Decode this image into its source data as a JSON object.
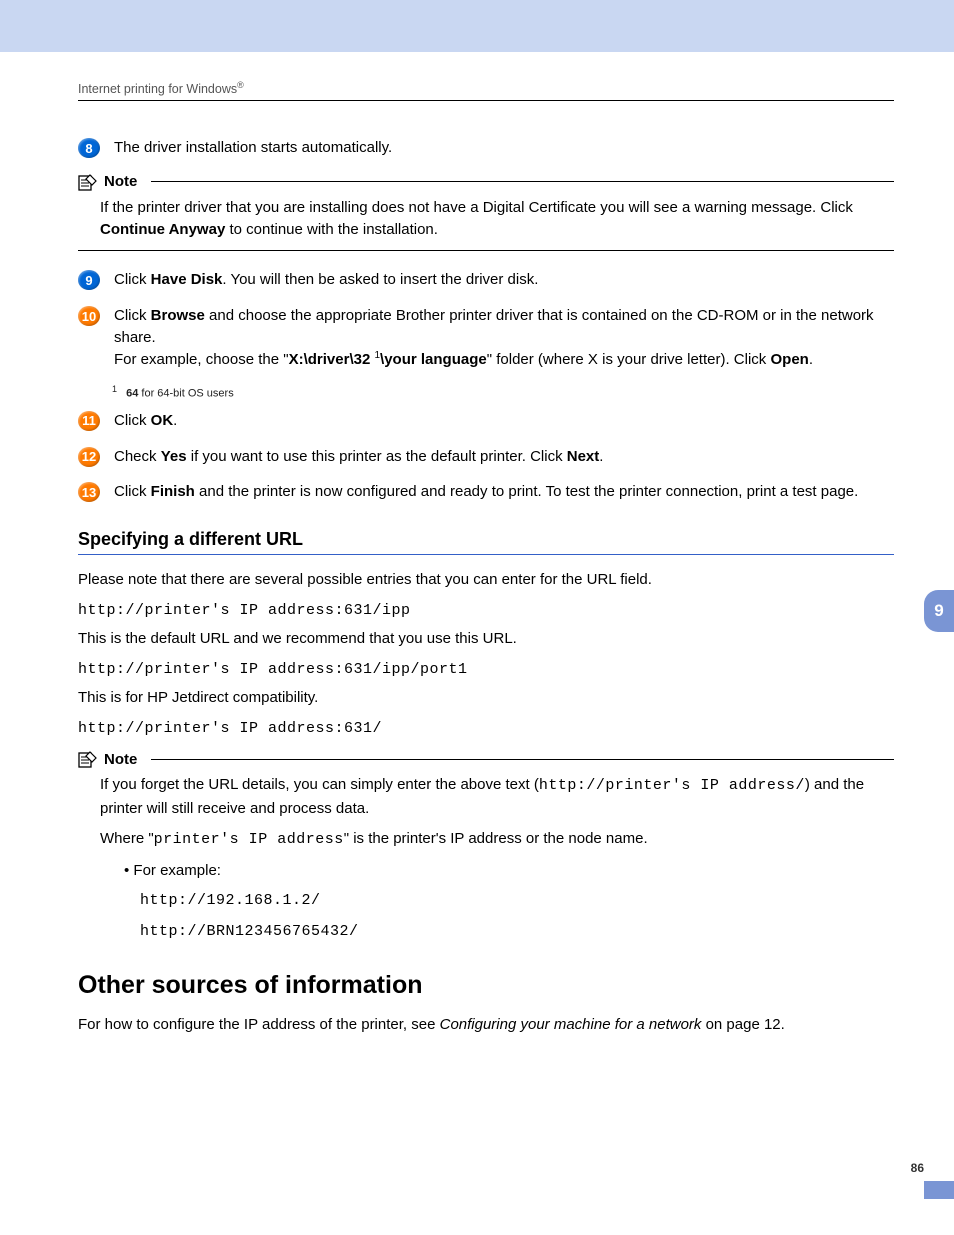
{
  "header": {
    "running_head": "Internet printing for Windows",
    "reg": "®"
  },
  "steps": [
    {
      "n": "8",
      "color": "blue",
      "html": "The driver installation starts automatically."
    },
    {
      "n": "9",
      "color": "blue",
      "html": "Click <b>Have Disk</b>. You will then be asked to insert the driver disk."
    },
    {
      "n": "10",
      "color": "orange",
      "html": "Click <b>Browse</b> and choose the appropriate Brother printer driver that is contained on the CD-ROM or in the network share.<br>For example, choose the \"<b>X:\\driver\\32</b> <sup class='supnote'>1</sup><b>\\your language</b>\" folder (where X is your drive letter). Click <b>Open</b>."
    },
    {
      "n": "11",
      "color": "orange",
      "html": "Click <b>OK</b>."
    },
    {
      "n": "12",
      "color": "orange",
      "html": "Check <b>Yes</b> if you want to use this printer as the default printer. Click <b>Next</b>."
    },
    {
      "n": "13",
      "color": "orange",
      "html": "Click <b>Finish</b> and the printer is now configured and ready to print. To test the printer connection, print a test page."
    }
  ],
  "footnote": {
    "mark": "1",
    "text": "64 for 64-bit OS users",
    "bold": "64"
  },
  "note1": {
    "label": "Note",
    "body_html": "If the printer driver that you are installing does not have a Digital Certificate you will see a warning message. Click <b>Continue Anyway</b> to continue with the installation."
  },
  "section_url": {
    "heading": "Specifying a different URL",
    "intro": "Please note that there are several possible entries that you can enter for the URL field.",
    "url1": "http://printer's IP address:631/ipp",
    "url1_desc": "This is the default URL and we recommend that you use this URL.",
    "url2": "http://printer's IP address:631/ipp/port1",
    "url2_desc": "This is for HP Jetdirect compatibility.",
    "url3": "http://printer's IP address:631/"
  },
  "note2": {
    "label": "Note",
    "line1_a": "If you forget the URL details, you can simply enter the above text (",
    "line1_code": "http://printer's IP address/",
    "line1_b": ") and the printer will still receive and process data.",
    "line2_a": "Where \"",
    "line2_code": "printer's IP address",
    "line2_b": "\" is the printer's IP address or the node name.",
    "bullet": "For example:",
    "ex1": "http://192.168.1.2/",
    "ex2": "http://BRN123456765432/"
  },
  "other": {
    "heading": "Other sources of information",
    "text_a": "For how to configure the IP address of the printer, see ",
    "text_italic": "Configuring your machine for a network",
    "text_b": " on page 12."
  },
  "chapter_tab": "9",
  "page_number": "86"
}
